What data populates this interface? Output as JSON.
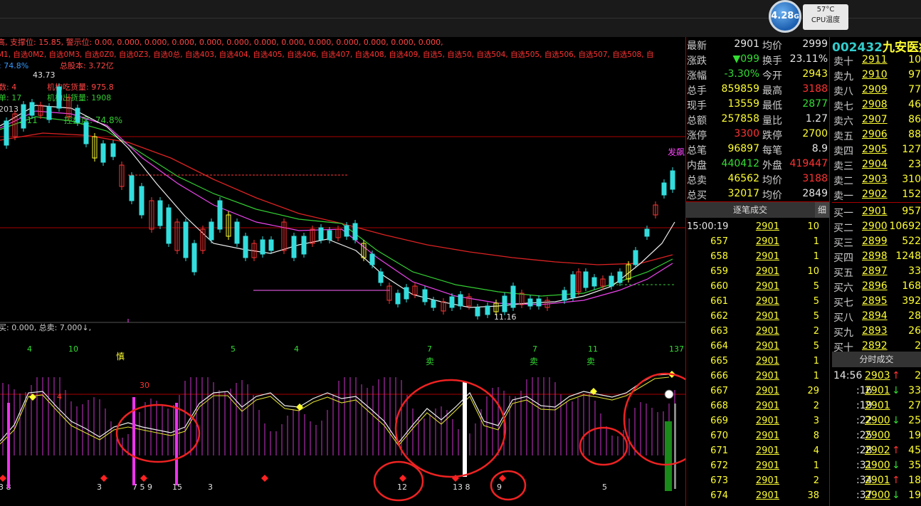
{
  "cpu": {
    "temp_value": "4.28",
    "temp_unit": "G",
    "temp_c": "57°C",
    "label": "CPU温度"
  },
  "stock": {
    "code": "002432",
    "name": "九安医疗"
  },
  "chart_header": {
    "line1": "高, 支撑位: 15.85, 警示位: 0.00, 0.000, 0.000, 0.000, 0.000, 0.000, 0.000, 0.000, 0.000, 0.000, 0.000, 0.000, 0.000,",
    "line2": "M1, 自选0M2, 自选0M3, 自选0Z0, 自选0Z3, 自选0总, 自选403, 自选404, 自选405, 自选406, 自选407, 自选408, 自选409, 自选5, 自选50, 自选504, 自选505, 自选506, 自选507, 自选508, 自",
    "legend1": "总股本: 3.72亿",
    "legend2": "机构吃货量: 975.8",
    "legend3": "机构出货量: 1908",
    "legend4": "控盘度: 74.8%",
    "left1": ": 74.8%",
    "left2": "数: 4",
    "left3": "单: 17",
    "left4": "2013",
    "left5": "1.11",
    "hi_label": "43.73",
    "lo_label": "11.16",
    "fa_label": "发飙"
  },
  "mid_bar": {
    "text": "买: 0.000, 总卖: 7.000↓,"
  },
  "indicator_labels": {
    "top_numbers": [
      "4",
      "10",
      "5",
      "4",
      "7",
      "7",
      "11",
      "137"
    ],
    "shen": "慎",
    "sell": [
      "卖",
      "卖",
      "卖"
    ],
    "bottom_numbers": [
      "3 8",
      "3",
      "7 5 9",
      "15",
      "3",
      "12",
      "13 8",
      "9",
      "5"
    ],
    "red_30": "30",
    "red_4": "4"
  },
  "quote": {
    "rows": [
      {
        "k1": "最新",
        "v1": "2901",
        "k2": "均价",
        "v2": "2999"
      },
      {
        "k1": "涨跌",
        "v1": "▼099",
        "k2": "换手",
        "v2": "23.11%"
      },
      {
        "k1": "涨幅",
        "v1": "-3.30%",
        "k2": "今开",
        "v2": "2943"
      },
      {
        "k1": "总手",
        "v1": "859859",
        "k2": "最高",
        "v2": "3188"
      },
      {
        "k1": "现手",
        "v1": "13559",
        "k2": "最低",
        "v2": "2877"
      },
      {
        "k1": "总额",
        "v1": "257858",
        "k2": "量比",
        "v2": "1.27"
      },
      {
        "k1": "涨停",
        "v1": "3300",
        "k2": "跌停",
        "v2": "2700"
      },
      {
        "k1": "总笔",
        "v1": "96897",
        "k2": "每笔",
        "v2": "8.9"
      },
      {
        "k1": "内盘",
        "v1": "440412",
        "k2": "外盘",
        "v2": "419447"
      },
      {
        "k1": "总卖",
        "v1": "46562",
        "k2": "均价",
        "v2": "3188"
      },
      {
        "k1": "总买",
        "v1": "32017",
        "k2": "均价",
        "v2": "2849"
      }
    ]
  },
  "trades": {
    "tab_label": "逐笔成交",
    "tab_btn": "细",
    "rows": [
      {
        "t": "15:00:19",
        "p": "2901",
        "v": "10"
      },
      {
        "t": "657",
        "p": "2901",
        "v": "1"
      },
      {
        "t": "658",
        "p": "2901",
        "v": "1"
      },
      {
        "t": "659",
        "p": "2901",
        "v": "10"
      },
      {
        "t": "660",
        "p": "2901",
        "v": "5"
      },
      {
        "t": "661",
        "p": "2901",
        "v": "5"
      },
      {
        "t": "662",
        "p": "2901",
        "v": "5"
      },
      {
        "t": "663",
        "p": "2901",
        "v": "2"
      },
      {
        "t": "664",
        "p": "2901",
        "v": "5"
      },
      {
        "t": "665",
        "p": "2901",
        "v": "1"
      },
      {
        "t": "666",
        "p": "2901",
        "v": "1"
      },
      {
        "t": "667",
        "p": "2901",
        "v": "29"
      },
      {
        "t": "668",
        "p": "2901",
        "v": "2"
      },
      {
        "t": "669",
        "p": "2901",
        "v": "3"
      },
      {
        "t": "670",
        "p": "2901",
        "v": "8"
      },
      {
        "t": "671",
        "p": "2901",
        "v": "4"
      },
      {
        "t": "672",
        "p": "2901",
        "v": "1"
      },
      {
        "t": "673",
        "p": "2901",
        "v": "2"
      },
      {
        "t": "674",
        "p": "2901",
        "v": "38"
      }
    ]
  },
  "orderbook": {
    "sell": [
      {
        "k": "卖十",
        "p": "2911",
        "v": "10"
      },
      {
        "k": "卖九",
        "p": "2910",
        "v": "97"
      },
      {
        "k": "卖八",
        "p": "2909",
        "v": "77"
      },
      {
        "k": "卖七",
        "p": "2908",
        "v": "46"
      },
      {
        "k": "卖六",
        "p": "2907",
        "v": "86"
      },
      {
        "k": "卖五",
        "p": "2906",
        "v": "88"
      },
      {
        "k": "卖四",
        "p": "2905",
        "v": "127"
      },
      {
        "k": "卖三",
        "p": "2904",
        "v": "23"
      },
      {
        "k": "卖二",
        "p": "2903",
        "v": "310"
      },
      {
        "k": "卖一",
        "p": "2902",
        "v": "152"
      }
    ],
    "buy": [
      {
        "k": "买一",
        "p": "2901",
        "v": "957"
      },
      {
        "k": "买二",
        "p": "2900",
        "v": "10692"
      },
      {
        "k": "买三",
        "p": "2899",
        "v": "522"
      },
      {
        "k": "买四",
        "p": "2898",
        "v": "1248"
      },
      {
        "k": "买五",
        "p": "2897",
        "v": "33"
      },
      {
        "k": "买六",
        "p": "2896",
        "v": "168"
      },
      {
        "k": "买七",
        "p": "2895",
        "v": "392"
      },
      {
        "k": "买八",
        "p": "2894",
        "v": "28"
      },
      {
        "k": "买九",
        "p": "2893",
        "v": "26"
      },
      {
        "k": "买十",
        "p": "2892",
        "v": "2"
      }
    ]
  },
  "timesales": {
    "label": "分时成交",
    "rows": [
      {
        "t": "14:56",
        "p": "2903",
        "a": "↑",
        "v": "2"
      },
      {
        "t": ":16",
        "p": "2901",
        "a": "↓",
        "v": "33"
      },
      {
        "t": ":19",
        "p": "2901",
        "a": "",
        "v": "27"
      },
      {
        "t": ":22",
        "p": "2900",
        "a": "↓",
        "v": "25"
      },
      {
        "t": ":25",
        "p": "2900",
        "a": "",
        "v": "19"
      },
      {
        "t": ":28",
        "p": "2902",
        "a": "↑",
        "v": "45"
      },
      {
        "t": ":31",
        "p": "2900",
        "a": "↓",
        "v": "35"
      },
      {
        "t": ":34",
        "p": "2901",
        "a": "↑",
        "v": "18"
      },
      {
        "t": ":37",
        "p": "2900",
        "a": "↓",
        "v": "19"
      }
    ]
  },
  "floating_badge": "4"
}
